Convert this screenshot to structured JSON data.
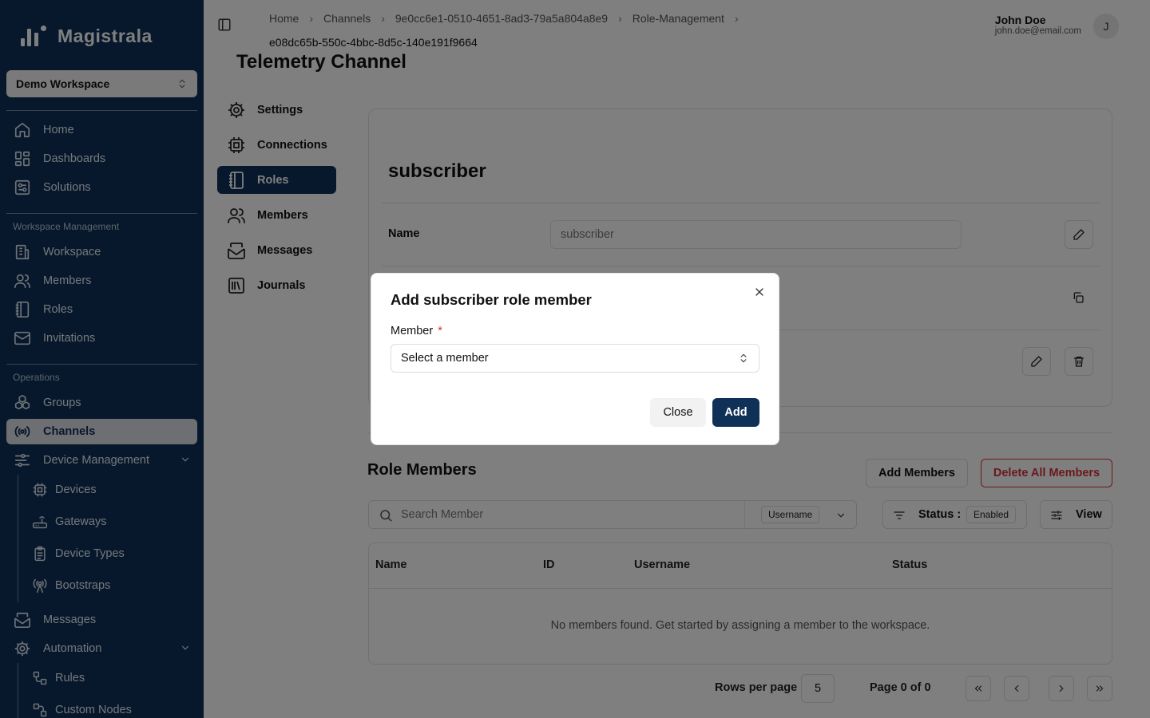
{
  "brand": {
    "name": "Magistrala"
  },
  "workspace_select": {
    "value": "Demo Workspace"
  },
  "sidebar": {
    "main_items": [
      {
        "label": "Home",
        "icon": "home-icon"
      },
      {
        "label": "Dashboards",
        "icon": "dashboard-icon"
      },
      {
        "label": "Solutions",
        "icon": "solutions-icon"
      }
    ],
    "workspace_group": "Workspace Management",
    "workspace_items": [
      {
        "label": "Workspace",
        "icon": "building-icon"
      },
      {
        "label": "Members",
        "icon": "users-icon"
      },
      {
        "label": "Roles",
        "icon": "notebook-icon"
      },
      {
        "label": "Invitations",
        "icon": "mail-icon"
      }
    ],
    "operations_group": "Operations",
    "operations_items": [
      {
        "label": "Groups",
        "icon": "groups-icon"
      },
      {
        "label": "Channels",
        "icon": "radio-icon"
      },
      {
        "label": "Device Management",
        "icon": "sliders-icon"
      }
    ],
    "device_sub": [
      {
        "label": "Devices",
        "icon": "cpu-icon"
      },
      {
        "label": "Gateways",
        "icon": "router-icon"
      },
      {
        "label": "Device Types",
        "icon": "clipboard-icon"
      },
      {
        "label": "Bootstraps",
        "icon": "antenna-icon"
      }
    ],
    "more_items": [
      {
        "label": "Messages",
        "icon": "mail-open-icon"
      },
      {
        "label": "Automation",
        "icon": "gear-icon"
      }
    ],
    "automation_sub": [
      {
        "label": "Rules",
        "icon": "workflow-icon"
      },
      {
        "label": "Custom Nodes",
        "icon": "nodes-icon"
      }
    ]
  },
  "breadcrumb": {
    "items": [
      "Home",
      "Channels",
      "9e0cc6e1-0510-4651-8ad3-79a5a804a8e9",
      "Role-Management"
    ],
    "last": "e08dc65b-550c-4bbc-8d5c-140e191f9664"
  },
  "user": {
    "name": "John Doe",
    "email": "john.doe@email.com",
    "initial": "J"
  },
  "page_title": "Telemetry Channel",
  "channel_nav": [
    {
      "label": "Settings",
      "icon": "gear-icon"
    },
    {
      "label": "Connections",
      "icon": "cpu-icon"
    },
    {
      "label": "Roles",
      "icon": "notebook-icon"
    },
    {
      "label": "Members",
      "icon": "users-icon"
    },
    {
      "label": "Messages",
      "icon": "mail-open-icon"
    },
    {
      "label": "Journals",
      "icon": "library-icon"
    }
  ],
  "role": {
    "title": "subscriber",
    "name_label": "Name",
    "name_value": "subscriber"
  },
  "members_section": {
    "title": "Role Members",
    "add_button": "Add Members",
    "delete_all_button": "Delete All Members",
    "search_placeholder": "Search Member",
    "search_field": "Username",
    "status_label": "Status :",
    "status_value": "Enabled",
    "view_label": "View",
    "columns": [
      "Name",
      "ID",
      "Username",
      "Status"
    ],
    "empty_message": "No members found. Get started by assigning a member to the workspace.",
    "rows_per_page_label": "Rows per page",
    "rows_per_page": "5",
    "page_info": "Page 0 of 0"
  },
  "dialog": {
    "title": "Add subscriber role member",
    "field_label": "Member",
    "required_mark": "*",
    "select_placeholder": "Select a member",
    "close_button": "Close",
    "add_button": "Add"
  },
  "colors": {
    "primary": "#0f3158",
    "danger": "#d8313a",
    "overlay": "rgba(0,0,0,0.5)"
  }
}
